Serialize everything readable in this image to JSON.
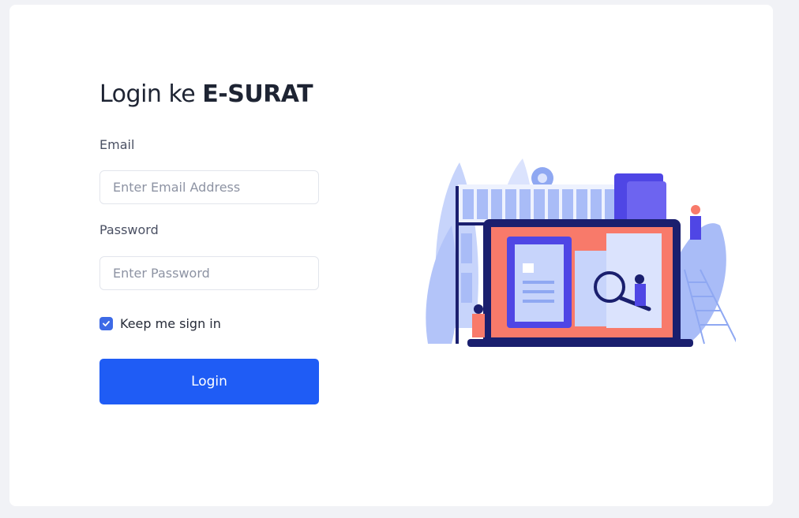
{
  "login": {
    "title_prefix": "Login ke",
    "title_brand": "E-SURAT",
    "email_label": "Email",
    "email_placeholder": "Enter Email Address",
    "email_value": "",
    "password_label": "Password",
    "password_placeholder": "Enter Password",
    "password_value": "",
    "remember_label": "Keep me sign in",
    "remember_checked": true,
    "button_label": "Login"
  },
  "colors": {
    "primary": "#1f5cf5",
    "checkbox": "#3d6ae6",
    "text_dark": "#1e2433",
    "illustration_blue": "#4f46e5",
    "illustration_coral": "#f87a6a"
  }
}
